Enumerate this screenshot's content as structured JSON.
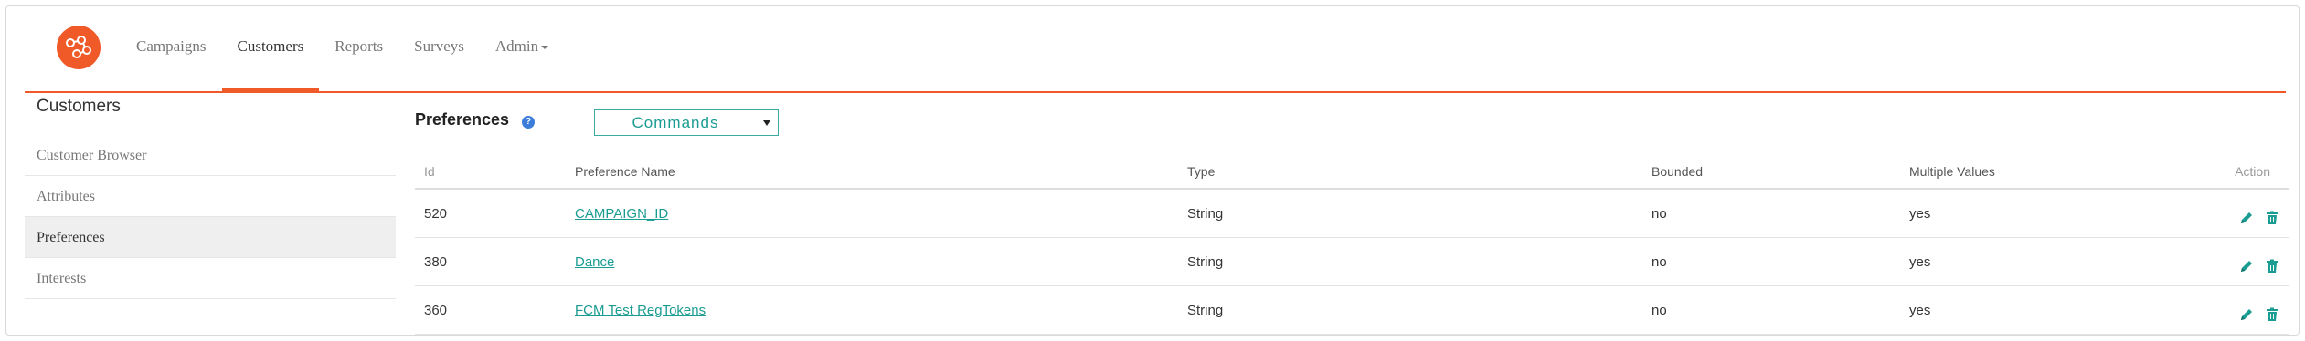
{
  "nav": {
    "items": [
      {
        "label": "Campaigns"
      },
      {
        "label": "Customers"
      },
      {
        "label": "Reports"
      },
      {
        "label": "Surveys"
      },
      {
        "label": "Admin"
      }
    ],
    "active": "Customers"
  },
  "sidebar": {
    "title": "Customers",
    "items": [
      {
        "label": "Customer Browser"
      },
      {
        "label": "Attributes"
      },
      {
        "label": "Preferences"
      },
      {
        "label": "Interests"
      }
    ],
    "active": "Preferences"
  },
  "main": {
    "title": "Preferences",
    "commands_label": "Commands",
    "columns": [
      "Id",
      "Preference Name",
      "Type",
      "Bounded",
      "Multiple Values",
      "Action"
    ],
    "rows": [
      {
        "id": "520",
        "name": "CAMPAIGN_ID",
        "type": "String",
        "bounded": "no",
        "multiple": "yes"
      },
      {
        "id": "380",
        "name": "Dance",
        "type": "String",
        "bounded": "no",
        "multiple": "yes"
      },
      {
        "id": "360",
        "name": "FCM Test RegTokens",
        "type": "String",
        "bounded": "no",
        "multiple": "yes"
      }
    ]
  },
  "colors": {
    "brand": "#ef5a28",
    "teal": "#1a9c92"
  },
  "icons": [
    "logo-icon",
    "help-icon",
    "dropdown-arrow-icon",
    "edit-pencil-icon",
    "delete-trash-icon"
  ]
}
